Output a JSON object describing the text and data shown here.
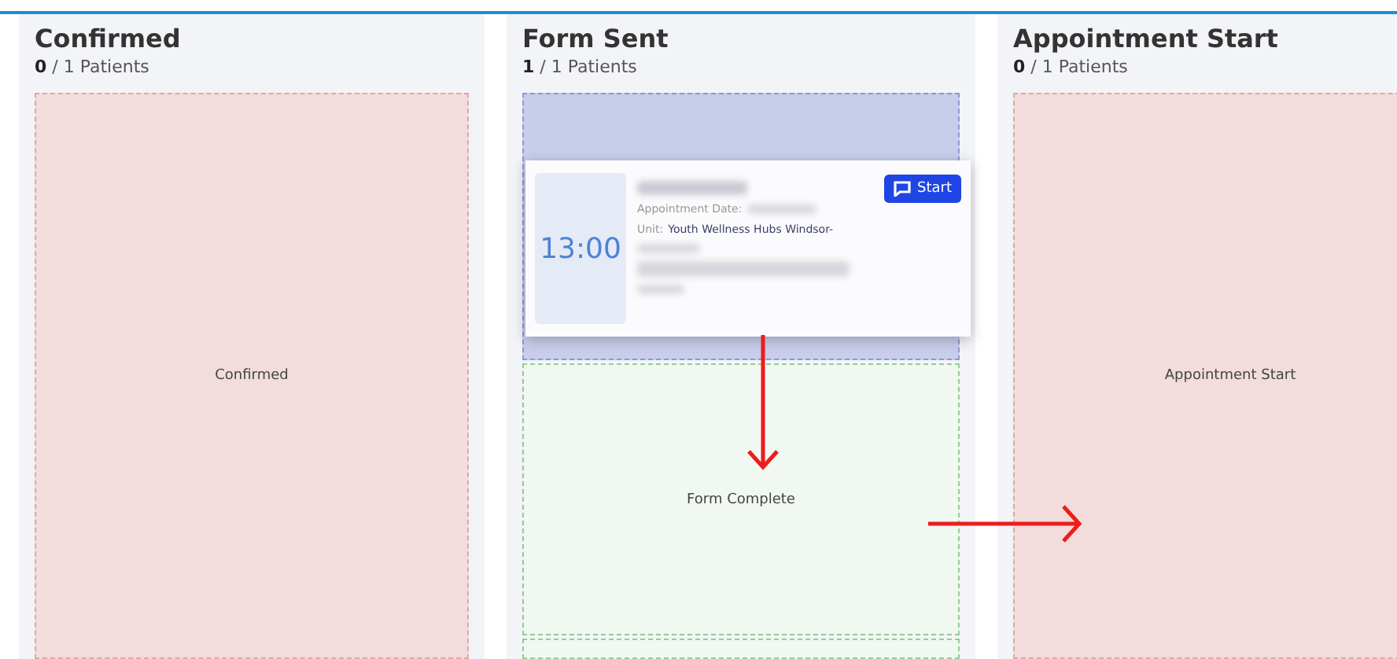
{
  "columns": [
    {
      "title": "Confirmed",
      "count": "**0** / 1 Patients",
      "zones": [
        {
          "label": "Confirmed",
          "color": "#f2dcdc"
        }
      ]
    },
    {
      "title": "Form Sent",
      "count": "**1** / 1 Patients",
      "zones": [
        {
          "color": "#c8cdea"
        },
        {
          "label": "Form Complete",
          "color": "#f1f7f1"
        },
        {
          "color": "#f1f7f1"
        }
      ]
    },
    {
      "title": "Appointment Start",
      "count": "**0** / 1 Patients",
      "zones": [
        {
          "label": "Appointment Start",
          "color": "#f2dcdc"
        }
      ]
    }
  ],
  "card": {
    "time": "13:00",
    "date_label": "Appointment Date:",
    "unit_label": "Unit:",
    "unit": "Youth Wellness Hubs Windsor-",
    "button": "Start"
  }
}
